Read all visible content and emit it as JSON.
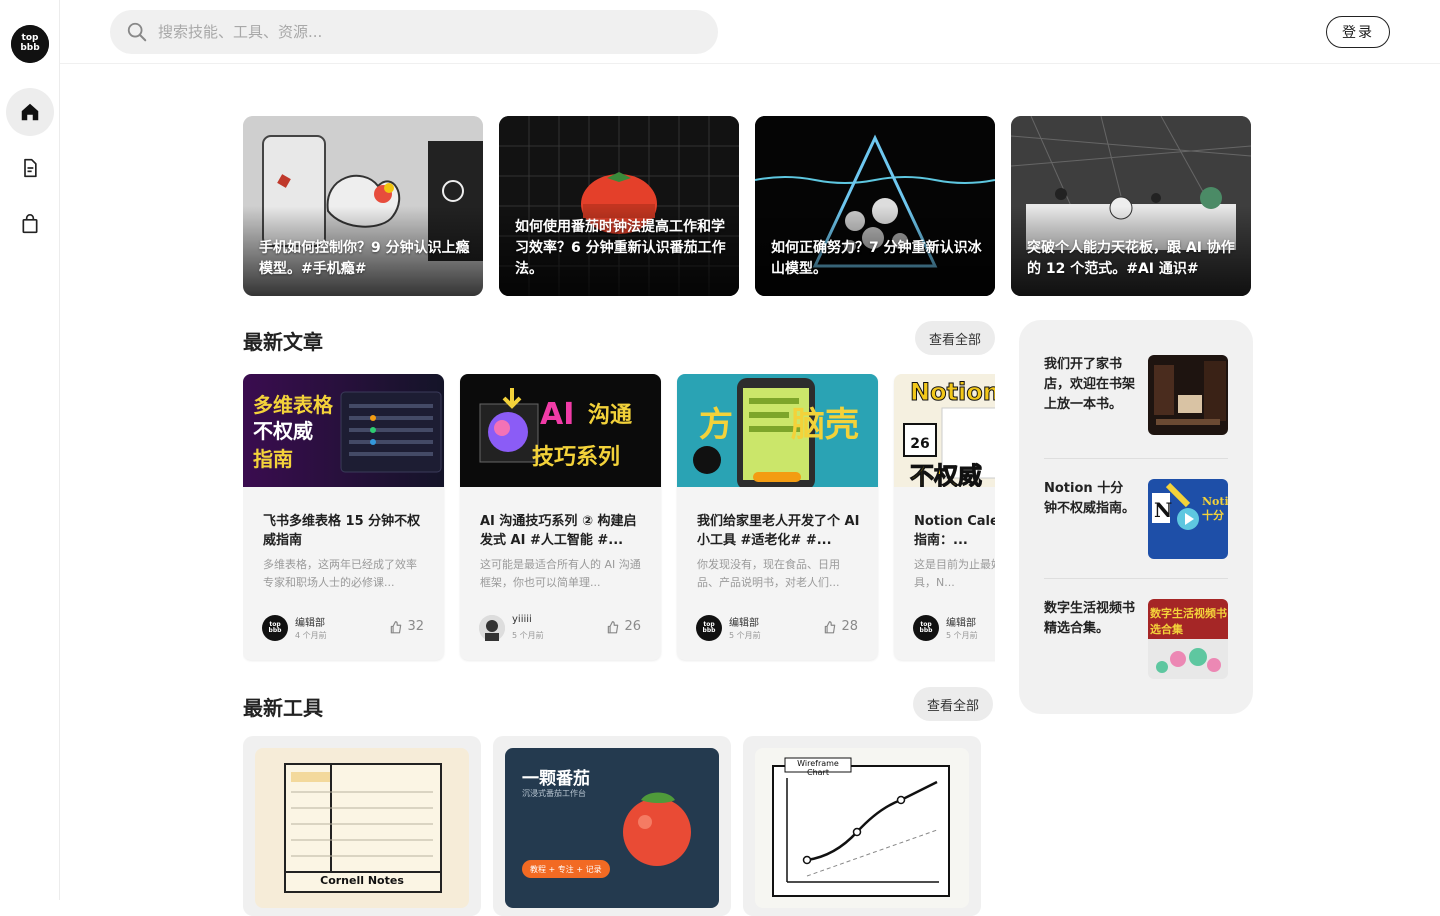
{
  "brand": {
    "logo_text": "top\nbbb"
  },
  "sidebar": {
    "items": [
      {
        "name": "home",
        "icon": "home-icon",
        "active": true
      },
      {
        "name": "articles",
        "icon": "document-icon",
        "active": false
      },
      {
        "name": "shop",
        "icon": "shopping-bag-icon",
        "active": false
      }
    ]
  },
  "header": {
    "search_placeholder": "搜索技能、工具、资源...",
    "login_label": "登录"
  },
  "featured": [
    {
      "title": "手机如何控制你？9 分钟认识上瘾模型。#手机瘾#"
    },
    {
      "title": "如何使用番茄时钟法提高工作和学习效率？6 分钟重新认识番茄工作法。"
    },
    {
      "title": "如何正确努力？7 分钟重新认识冰山模型。"
    },
    {
      "title": "突破个人能力天花板，跟 AI 协作的 12 个范式。#AI 通识#"
    }
  ],
  "latest_articles": {
    "heading": "最新文章",
    "view_all": "查看全部",
    "items": [
      {
        "cover_text": "多维表格\n不权威\n指南",
        "title": "飞书多维表格 15 分钟不权威指南",
        "excerpt": "多维表格，这两年已经成了效率专家和职场人士的必修课...",
        "author": "编辑部",
        "time": "4 个月前",
        "likes": "32"
      },
      {
        "cover_text": "AI沟通\n技巧系列",
        "title": "AI 沟通技巧系列 ② 构建启发式 AI #人工智能 #...",
        "excerpt": "这可能是最适合所有人的 AI 沟通框架，你也可以简单理...",
        "author": "yiiiii",
        "time": "5 个月前",
        "likes": "26"
      },
      {
        "cover_text": "方 脑壳",
        "title": "我们给家里老人开发了个 AI 小工具 #适老化# #...",
        "excerpt": "你发现没有，现在食品、日用品、产品说明书，对老人们...",
        "author": "编辑部",
        "time": "5 个月前",
        "likes": "28"
      },
      {
        "cover_text": "Notion\n不权威",
        "title": "Notion Calendar 不权威指南：...",
        "excerpt": "这是目前为止最好用的日历工具，N...",
        "author": "编辑部",
        "time": "5 个月前",
        "likes": ""
      }
    ]
  },
  "right_panel": {
    "items": [
      {
        "title": "我们开了家书店，欢迎在书架上放一本书。"
      },
      {
        "title": "Notion 十分钟不权威指南。"
      },
      {
        "title": "数字生活视频书精选合集。"
      }
    ]
  },
  "latest_tools": {
    "heading": "最新工具",
    "view_all": "查看全部",
    "items": [
      {
        "label": "Cornell Notes"
      },
      {
        "label": "一颗番茄",
        "sub": "沉浸式番茄工作台",
        "tag": "教程 + 专注 + 记录"
      },
      {
        "label": "Wireframe Chart"
      }
    ]
  },
  "colors": {
    "accent": "#111111",
    "panel_bg": "#f1f1f1",
    "tomato": "#e94b35"
  }
}
